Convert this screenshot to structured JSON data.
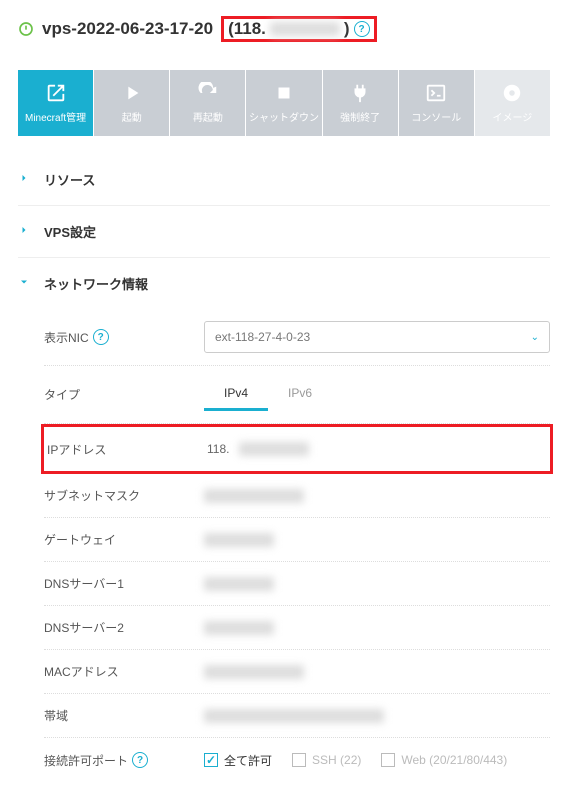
{
  "header": {
    "title": "vps-2022-06-23-17-20",
    "ip_prefix": "(118.",
    "ip_suffix": ")"
  },
  "toolbar": [
    {
      "key": "minecraft",
      "label": "Minecraft管理",
      "active": true
    },
    {
      "key": "start",
      "label": "起動",
      "active": false
    },
    {
      "key": "restart",
      "label": "再起動",
      "active": false
    },
    {
      "key": "shutdown",
      "label": "シャットダウン",
      "active": false
    },
    {
      "key": "forcestop",
      "label": "強制終了",
      "active": false
    },
    {
      "key": "console",
      "label": "コンソール",
      "active": false
    },
    {
      "key": "image",
      "label": "イメージ",
      "active": false,
      "light": true
    }
  ],
  "sections": {
    "resource": "リソース",
    "vps_settings": "VPS設定",
    "network": "ネットワーク情報"
  },
  "network": {
    "nic_label": "表示NIC",
    "nic_value": "ext-118-27-4-0-23",
    "type_label": "タイプ",
    "ipv4": "IPv4",
    "ipv6": "IPv6",
    "ip_label": "IPアドレス",
    "ip_value": "118.",
    "subnet_label": "サブネットマスク",
    "gateway_label": "ゲートウェイ",
    "dns1_label": "DNSサーバー1",
    "dns2_label": "DNSサーバー2",
    "mac_label": "MACアドレス",
    "bandwidth_label": "帯域",
    "ports_label": "接続許可ポート",
    "allow_all": "全て許可",
    "ssh": "SSH (22)",
    "web": "Web (20/21/80/443)"
  }
}
